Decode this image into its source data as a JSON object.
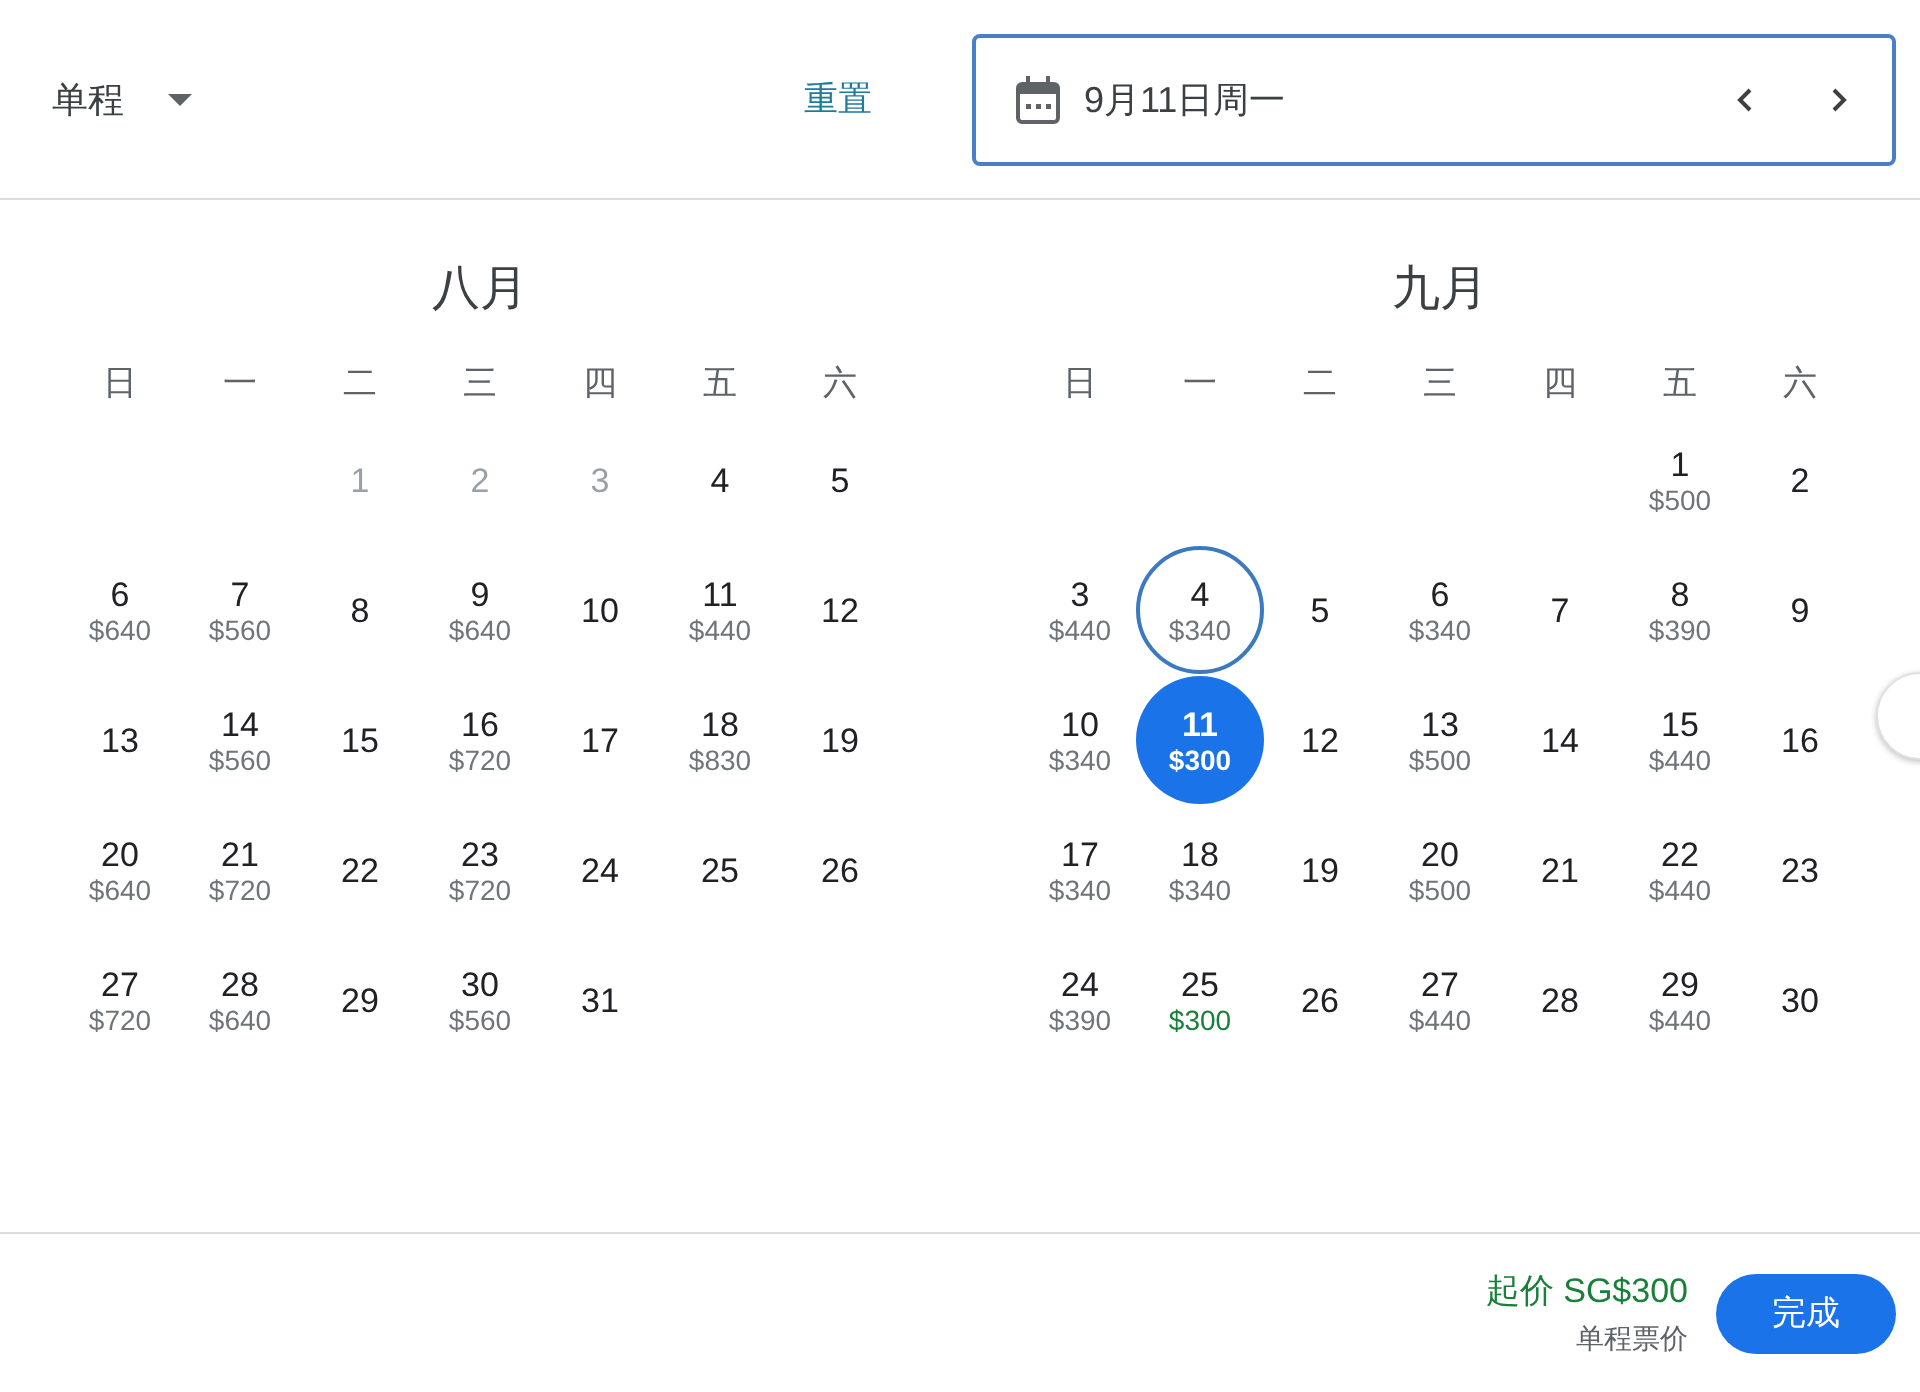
{
  "trip_type": {
    "label": "单程"
  },
  "reset": "重置",
  "date_field": {
    "value": "9月11日周一"
  },
  "months": [
    {
      "title": "八月",
      "weekdays": [
        "日",
        "一",
        "二",
        "三",
        "四",
        "五",
        "六"
      ],
      "days": [
        {
          "kind": "blank"
        },
        {
          "kind": "blank"
        },
        {
          "kind": "date",
          "day": "1",
          "disabled": true,
          "selected": false,
          "outlined": false
        },
        {
          "kind": "date",
          "day": "2",
          "disabled": true,
          "selected": false,
          "outlined": false
        },
        {
          "kind": "date",
          "day": "3",
          "disabled": true,
          "selected": false,
          "outlined": false
        },
        {
          "kind": "date",
          "day": "4",
          "disabled": false,
          "selected": false,
          "outlined": false
        },
        {
          "kind": "date",
          "day": "5",
          "disabled": false,
          "selected": false,
          "outlined": false
        },
        {
          "kind": "date",
          "day": "6",
          "price": {
            "text": "$640",
            "lowest": false
          },
          "disabled": false,
          "selected": false,
          "outlined": false
        },
        {
          "kind": "date",
          "day": "7",
          "price": {
            "text": "$560",
            "lowest": false
          },
          "disabled": false,
          "selected": false,
          "outlined": false
        },
        {
          "kind": "date",
          "day": "8",
          "disabled": false,
          "selected": false,
          "outlined": false
        },
        {
          "kind": "date",
          "day": "9",
          "price": {
            "text": "$640",
            "lowest": false
          },
          "disabled": false,
          "selected": false,
          "outlined": false
        },
        {
          "kind": "date",
          "day": "10",
          "disabled": false,
          "selected": false,
          "outlined": false
        },
        {
          "kind": "date",
          "day": "11",
          "price": {
            "text": "$440",
            "lowest": false
          },
          "disabled": false,
          "selected": false,
          "outlined": false
        },
        {
          "kind": "date",
          "day": "12",
          "disabled": false,
          "selected": false,
          "outlined": false
        },
        {
          "kind": "date",
          "day": "13",
          "disabled": false,
          "selected": false,
          "outlined": false
        },
        {
          "kind": "date",
          "day": "14",
          "price": {
            "text": "$560",
            "lowest": false
          },
          "disabled": false,
          "selected": false,
          "outlined": false
        },
        {
          "kind": "date",
          "day": "15",
          "disabled": false,
          "selected": false,
          "outlined": false
        },
        {
          "kind": "date",
          "day": "16",
          "price": {
            "text": "$720",
            "lowest": false
          },
          "disabled": false,
          "selected": false,
          "outlined": false
        },
        {
          "kind": "date",
          "day": "17",
          "disabled": false,
          "selected": false,
          "outlined": false
        },
        {
          "kind": "date",
          "day": "18",
          "price": {
            "text": "$830",
            "lowest": false
          },
          "disabled": false,
          "selected": false,
          "outlined": false
        },
        {
          "kind": "date",
          "day": "19",
          "disabled": false,
          "selected": false,
          "outlined": false
        },
        {
          "kind": "date",
          "day": "20",
          "price": {
            "text": "$640",
            "lowest": false
          },
          "disabled": false,
          "selected": false,
          "outlined": false
        },
        {
          "kind": "date",
          "day": "21",
          "price": {
            "text": "$720",
            "lowest": false
          },
          "disabled": false,
          "selected": false,
          "outlined": false
        },
        {
          "kind": "date",
          "day": "22",
          "disabled": false,
          "selected": false,
          "outlined": false
        },
        {
          "kind": "date",
          "day": "23",
          "price": {
            "text": "$720",
            "lowest": false
          },
          "disabled": false,
          "selected": false,
          "outlined": false
        },
        {
          "kind": "date",
          "day": "24",
          "disabled": false,
          "selected": false,
          "outlined": false
        },
        {
          "kind": "date",
          "day": "25",
          "disabled": false,
          "selected": false,
          "outlined": false
        },
        {
          "kind": "date",
          "day": "26",
          "disabled": false,
          "selected": false,
          "outlined": false
        },
        {
          "kind": "date",
          "day": "27",
          "price": {
            "text": "$720",
            "lowest": false
          },
          "disabled": false,
          "selected": false,
          "outlined": false
        },
        {
          "kind": "date",
          "day": "28",
          "price": {
            "text": "$640",
            "lowest": false
          },
          "disabled": false,
          "selected": false,
          "outlined": false
        },
        {
          "kind": "date",
          "day": "29",
          "disabled": false,
          "selected": false,
          "outlined": false
        },
        {
          "kind": "date",
          "day": "30",
          "price": {
            "text": "$560",
            "lowest": false
          },
          "disabled": false,
          "selected": false,
          "outlined": false
        },
        {
          "kind": "date",
          "day": "31",
          "disabled": false,
          "selected": false,
          "outlined": false
        }
      ]
    },
    {
      "title": "九月",
      "weekdays": [
        "日",
        "一",
        "二",
        "三",
        "四",
        "五",
        "六"
      ],
      "days": [
        {
          "kind": "blank"
        },
        {
          "kind": "blank"
        },
        {
          "kind": "blank"
        },
        {
          "kind": "blank"
        },
        {
          "kind": "blank"
        },
        {
          "kind": "date",
          "day": "1",
          "price": {
            "text": "$500",
            "lowest": false
          },
          "disabled": false,
          "selected": false,
          "outlined": false
        },
        {
          "kind": "date",
          "day": "2",
          "disabled": false,
          "selected": false,
          "outlined": false
        },
        {
          "kind": "date",
          "day": "3",
          "price": {
            "text": "$440",
            "lowest": false
          },
          "disabled": false,
          "selected": false,
          "outlined": false
        },
        {
          "kind": "date",
          "day": "4",
          "price": {
            "text": "$340",
            "lowest": false
          },
          "disabled": false,
          "selected": false,
          "outlined": true
        },
        {
          "kind": "date",
          "day": "5",
          "disabled": false,
          "selected": false,
          "outlined": false
        },
        {
          "kind": "date",
          "day": "6",
          "price": {
            "text": "$340",
            "lowest": false
          },
          "disabled": false,
          "selected": false,
          "outlined": false
        },
        {
          "kind": "date",
          "day": "7",
          "disabled": false,
          "selected": false,
          "outlined": false
        },
        {
          "kind": "date",
          "day": "8",
          "price": {
            "text": "$390",
            "lowest": false
          },
          "disabled": false,
          "selected": false,
          "outlined": false
        },
        {
          "kind": "date",
          "day": "9",
          "disabled": false,
          "selected": false,
          "outlined": false
        },
        {
          "kind": "date",
          "day": "10",
          "price": {
            "text": "$340",
            "lowest": false
          },
          "disabled": false,
          "selected": false,
          "outlined": false
        },
        {
          "kind": "date",
          "day": "11",
          "price": {
            "text": "$300",
            "lowest": false
          },
          "disabled": false,
          "selected": true,
          "outlined": false
        },
        {
          "kind": "date",
          "day": "12",
          "disabled": false,
          "selected": false,
          "outlined": false
        },
        {
          "kind": "date",
          "day": "13",
          "price": {
            "text": "$500",
            "lowest": false
          },
          "disabled": false,
          "selected": false,
          "outlined": false
        },
        {
          "kind": "date",
          "day": "14",
          "disabled": false,
          "selected": false,
          "outlined": false
        },
        {
          "kind": "date",
          "day": "15",
          "price": {
            "text": "$440",
            "lowest": false
          },
          "disabled": false,
          "selected": false,
          "outlined": false
        },
        {
          "kind": "date",
          "day": "16",
          "disabled": false,
          "selected": false,
          "outlined": false
        },
        {
          "kind": "date",
          "day": "17",
          "price": {
            "text": "$340",
            "lowest": false
          },
          "disabled": false,
          "selected": false,
          "outlined": false
        },
        {
          "kind": "date",
          "day": "18",
          "price": {
            "text": "$340",
            "lowest": false
          },
          "disabled": false,
          "selected": false,
          "outlined": false
        },
        {
          "kind": "date",
          "day": "19",
          "disabled": false,
          "selected": false,
          "outlined": false
        },
        {
          "kind": "date",
          "day": "20",
          "price": {
            "text": "$500",
            "lowest": false
          },
          "disabled": false,
          "selected": false,
          "outlined": false
        },
        {
          "kind": "date",
          "day": "21",
          "disabled": false,
          "selected": false,
          "outlined": false
        },
        {
          "kind": "date",
          "day": "22",
          "price": {
            "text": "$440",
            "lowest": false
          },
          "disabled": false,
          "selected": false,
          "outlined": false
        },
        {
          "kind": "date",
          "day": "23",
          "disabled": false,
          "selected": false,
          "outlined": false
        },
        {
          "kind": "date",
          "day": "24",
          "price": {
            "text": "$390",
            "lowest": false
          },
          "disabled": false,
          "selected": false,
          "outlined": false
        },
        {
          "kind": "date",
          "day": "25",
          "price": {
            "text": "$300",
            "lowest": true
          },
          "disabled": false,
          "selected": false,
          "outlined": false
        },
        {
          "kind": "date",
          "day": "26",
          "disabled": false,
          "selected": false,
          "outlined": false
        },
        {
          "kind": "date",
          "day": "27",
          "price": {
            "text": "$440",
            "lowest": false
          },
          "disabled": false,
          "selected": false,
          "outlined": false
        },
        {
          "kind": "date",
          "day": "28",
          "disabled": false,
          "selected": false,
          "outlined": false
        },
        {
          "kind": "date",
          "day": "29",
          "price": {
            "text": "$440",
            "lowest": false
          },
          "disabled": false,
          "selected": false,
          "outlined": false
        },
        {
          "kind": "date",
          "day": "30",
          "disabled": false,
          "selected": false,
          "outlined": false
        }
      ]
    }
  ],
  "footer": {
    "price": "起价 SG$300",
    "price_note": "单程票价",
    "done": "完成"
  }
}
